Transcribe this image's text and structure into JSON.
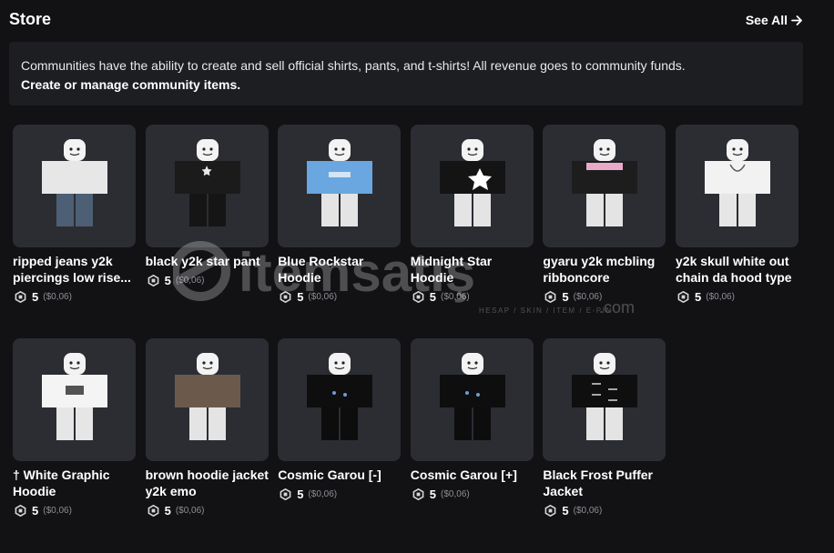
{
  "store": {
    "title": "Store",
    "see_all": "See All"
  },
  "banner": {
    "text": "Communities have the ability to create and sell official shirts, pants, and t-shirts! All revenue goes to community funds.",
    "link": "Create or manage community items."
  },
  "colors": {
    "background": "#121215",
    "card": "#2b2d33",
    "banner": "#1d1e22",
    "muted_text": "#8d8f95"
  },
  "icons": {
    "currency": "robux-icon",
    "arrow": "arrow-right-icon"
  },
  "items": [
    {
      "name": "ripped jeans y2k piercings low rise...",
      "price": "5",
      "usd": "($0,06)",
      "style": "jeans"
    },
    {
      "name": "black y2k star pant",
      "price": "5",
      "usd": "($0,06)",
      "style": "blackstar"
    },
    {
      "name": "Blue Rockstar Hoodie",
      "price": "5",
      "usd": "($0,06)",
      "style": "blue"
    },
    {
      "name": "Midnight Star Hoodie",
      "price": "5",
      "usd": "($0,06)",
      "style": "midnight"
    },
    {
      "name": "gyaru y2k mcbling ribboncore",
      "price": "5",
      "usd": "($0,06)",
      "style": "gyaru"
    },
    {
      "name": "y2k skull white out chain da hood type",
      "price": "5",
      "usd": "($0,06)",
      "style": "white"
    },
    {
      "name": "† White Graphic Hoodie",
      "price": "5",
      "usd": "($0,06)",
      "style": "whitegraphic"
    },
    {
      "name": "brown hoodie jacket y2k emo",
      "price": "5",
      "usd": "($0,06)",
      "style": "brown"
    },
    {
      "name": "Cosmic Garou [-]",
      "price": "5",
      "usd": "($0,06)",
      "style": "cosmic"
    },
    {
      "name": "Cosmic Garou [+]",
      "price": "5",
      "usd": "($0,06)",
      "style": "cosmic"
    },
    {
      "name": "Black Frost Puffer Jacket",
      "price": "5",
      "usd": "($0,06)",
      "style": "frost"
    }
  ],
  "watermark": {
    "brand": "itemsatış",
    "suffix": ".com",
    "tagline": "HESAP / SKIN / ITEM / E-PIN"
  }
}
